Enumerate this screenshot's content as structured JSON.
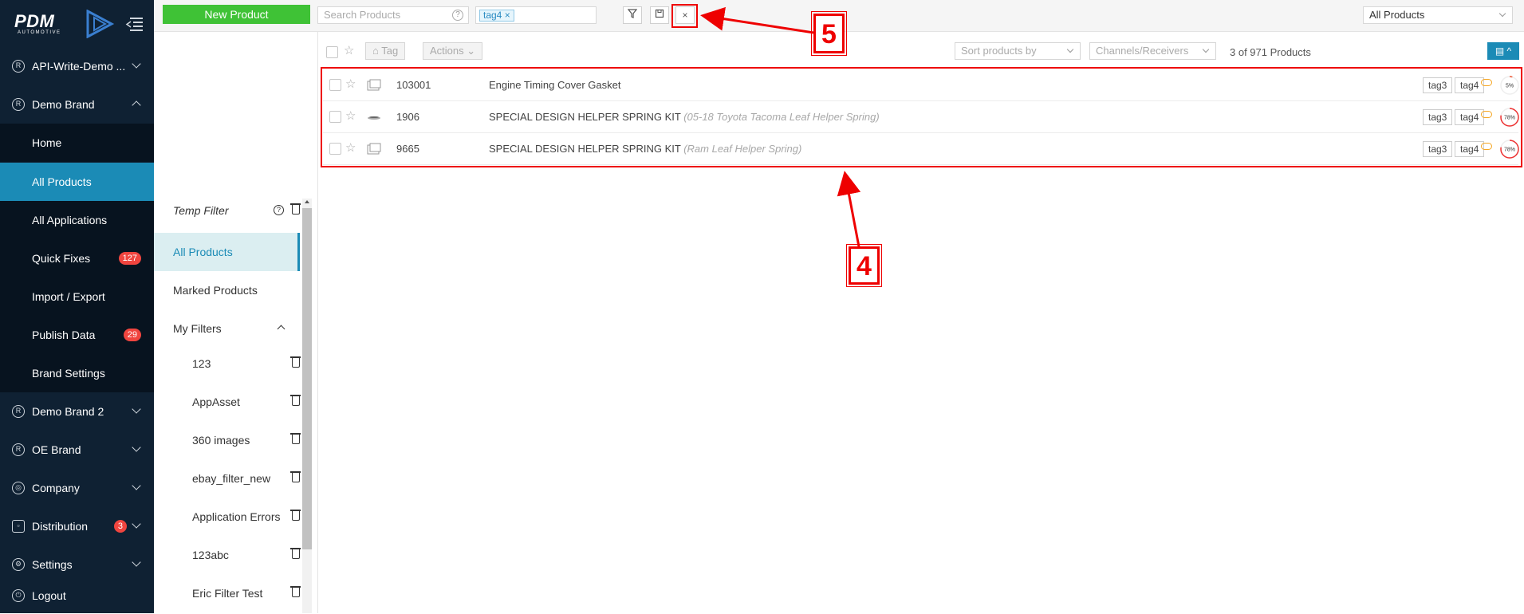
{
  "sidebar": {
    "logo_text": "PDM",
    "logo_sub": "AUTOMOTIVE",
    "items": [
      {
        "label": "API-Write-Demo ...",
        "icon": "registered-icon"
      },
      {
        "label": "Demo Brand",
        "icon": "registered-icon"
      },
      {
        "label": "Home"
      },
      {
        "label": "All Products"
      },
      {
        "label": "All Applications"
      },
      {
        "label": "Quick Fixes",
        "badge": "127"
      },
      {
        "label": "Import / Export"
      },
      {
        "label": "Publish Data",
        "badge": "29"
      },
      {
        "label": "Brand Settings"
      },
      {
        "label": "Demo Brand 2",
        "icon": "registered-icon"
      },
      {
        "label": "OE Brand",
        "icon": "registered-icon"
      },
      {
        "label": "Company",
        "icon": "globe-icon"
      },
      {
        "label": "Distribution",
        "icon": "distribution-icon",
        "badge": "3"
      },
      {
        "label": "Settings",
        "icon": "gear-icon"
      },
      {
        "label": "Logout",
        "icon": "logout-icon"
      }
    ]
  },
  "topbar": {
    "new_product_label": "New Product",
    "search_placeholder": "Search Products",
    "tag_chip": "tag4",
    "product_select": "All Products"
  },
  "filters": {
    "temp_filter": "Temp Filter",
    "all_products": "All Products",
    "marked_products": "Marked Products",
    "my_filters": "My Filters",
    "saved": [
      "123",
      "AppAsset",
      "360 images",
      "ebay_filter_new",
      "Application Errors",
      "123abc",
      "Eric Filter Test"
    ]
  },
  "list": {
    "tag_button": "Tag",
    "actions_button": "Actions",
    "sort_placeholder": "Sort products by",
    "channels_placeholder": "Channels/Receivers",
    "count": "3 of 971 Products",
    "rows": [
      {
        "number": "103001",
        "name": "Engine Timing Cover Gasket",
        "sub": "",
        "tags": [
          "tag3",
          "tag4"
        ],
        "progress": "5%",
        "progress_value": 0.05
      },
      {
        "number": "1906",
        "name": "SPECIAL DESIGN HELPER SPRING KIT",
        "sub": "(05-18 Toyota Tacoma Leaf Helper Spring)",
        "tags": [
          "tag3",
          "tag4"
        ],
        "progress": "78%",
        "progress_value": 0.78
      },
      {
        "number": "9665",
        "name": "SPECIAL DESIGN HELPER SPRING KIT",
        "sub": "(Ram Leaf Helper Spring)",
        "tags": [
          "tag3",
          "tag4"
        ],
        "progress": "78%",
        "progress_value": 0.78
      }
    ]
  },
  "annotations": {
    "callout_5": "5",
    "callout_4": "4",
    "color": "#e00000"
  }
}
